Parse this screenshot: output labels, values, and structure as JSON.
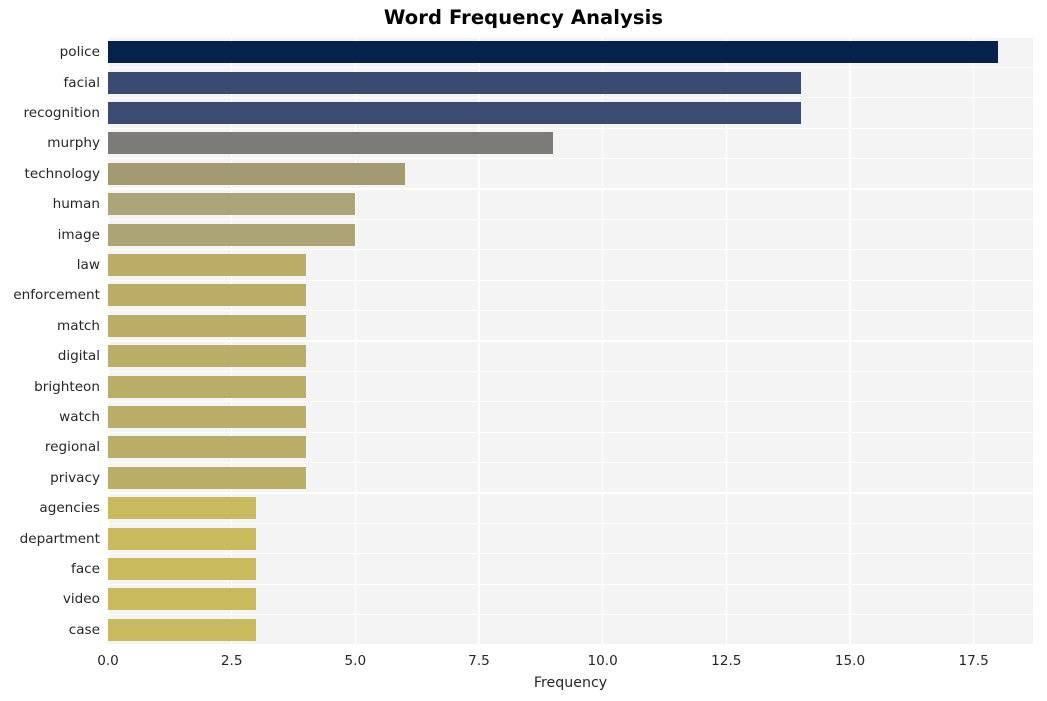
{
  "chart_data": {
    "type": "bar",
    "orientation": "horizontal",
    "title": "Word Frequency Analysis",
    "xlabel": "Frequency",
    "ylabel": "",
    "categories": [
      "police",
      "facial",
      "recognition",
      "murphy",
      "technology",
      "human",
      "image",
      "law",
      "enforcement",
      "match",
      "digital",
      "brighteon",
      "watch",
      "regional",
      "privacy",
      "agencies",
      "department",
      "face",
      "video",
      "case"
    ],
    "values": [
      18,
      14,
      14,
      9,
      6,
      5,
      5,
      4,
      4,
      4,
      4,
      4,
      4,
      4,
      4,
      3,
      3,
      3,
      3,
      3
    ],
    "bar_colors": [
      "#04224c",
      "#3b4a71",
      "#3c4b72",
      "#7c7b77",
      "#a39a72",
      "#ad a477",
      "#aca477",
      "#b9ad67",
      "#b9ad67",
      "#b9ad67",
      "#b9ad67",
      "#b9ad67",
      "#b9ad67",
      "#b9ad67",
      "#b9ad67",
      "#c9bb5d",
      "#c9bb5d",
      "#c9bb5d",
      "#c9bb5d",
      "#c9bb5d"
    ],
    "xlim": [
      0,
      18.7
    ],
    "xticks": [
      0.0,
      2.5,
      5.0,
      7.5,
      10.0,
      12.5,
      15.0,
      17.5
    ],
    "xtick_labels": [
      "0.0",
      "2.5",
      "5.0",
      "7.5",
      "10.0",
      "12.5",
      "15.0",
      "17.5"
    ],
    "grid": true,
    "grid_color": "#ffffff",
    "panel_color": "#f4f4f5",
    "legend": null,
    "style": "whitegrid"
  }
}
